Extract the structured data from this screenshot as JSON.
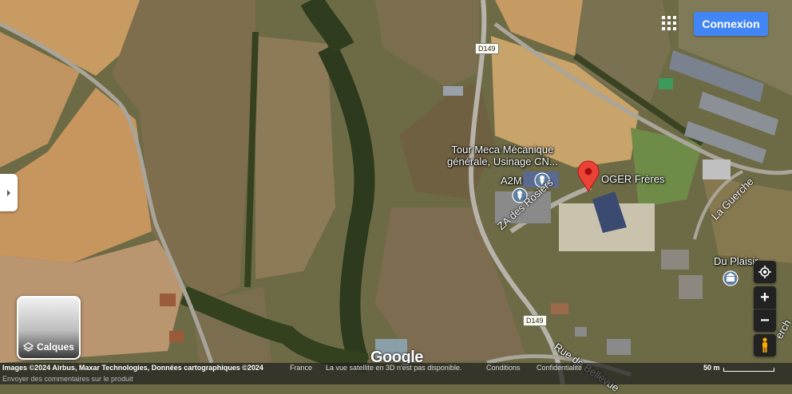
{
  "header": {
    "login_label": "Connexion",
    "apps_icon": "apps-grid-icon"
  },
  "places": {
    "tour_meca_line1": "Tour Meca Mécanique",
    "tour_meca_line2": "générale, Usinage CN...",
    "a2m": "A2M",
    "oger": "OGER Frères",
    "du_plaisir": "Du Plaisir"
  },
  "roads": {
    "d149_top": "D149",
    "d149_bottom": "D149",
    "za_rosiers": "ZA des Rosiers",
    "la_guerche": "La Guerche",
    "rue_bellevue": "Rue de Bellevue",
    "guerche_edge": "erch"
  },
  "layers_button": {
    "label": "Calques"
  },
  "footer": {
    "attribution": "Images ©2024 Airbus, Maxar Technologies, Données cartographiques ©2024",
    "country": "France",
    "notice": "La vue satellite en 3D n'est pas disponible.",
    "conditions": "Conditions",
    "privacy": "Confidentialité",
    "scale": "50 m",
    "feedback": "Envoyer des commentaires sur le produit"
  },
  "logo": "Google",
  "controls": {
    "zoom_in": "+",
    "zoom_out": "−"
  },
  "colors": {
    "pin": "#ea4335",
    "login": "#4285f4",
    "control_bg": "#222222",
    "pegman": "#f9ab00"
  }
}
